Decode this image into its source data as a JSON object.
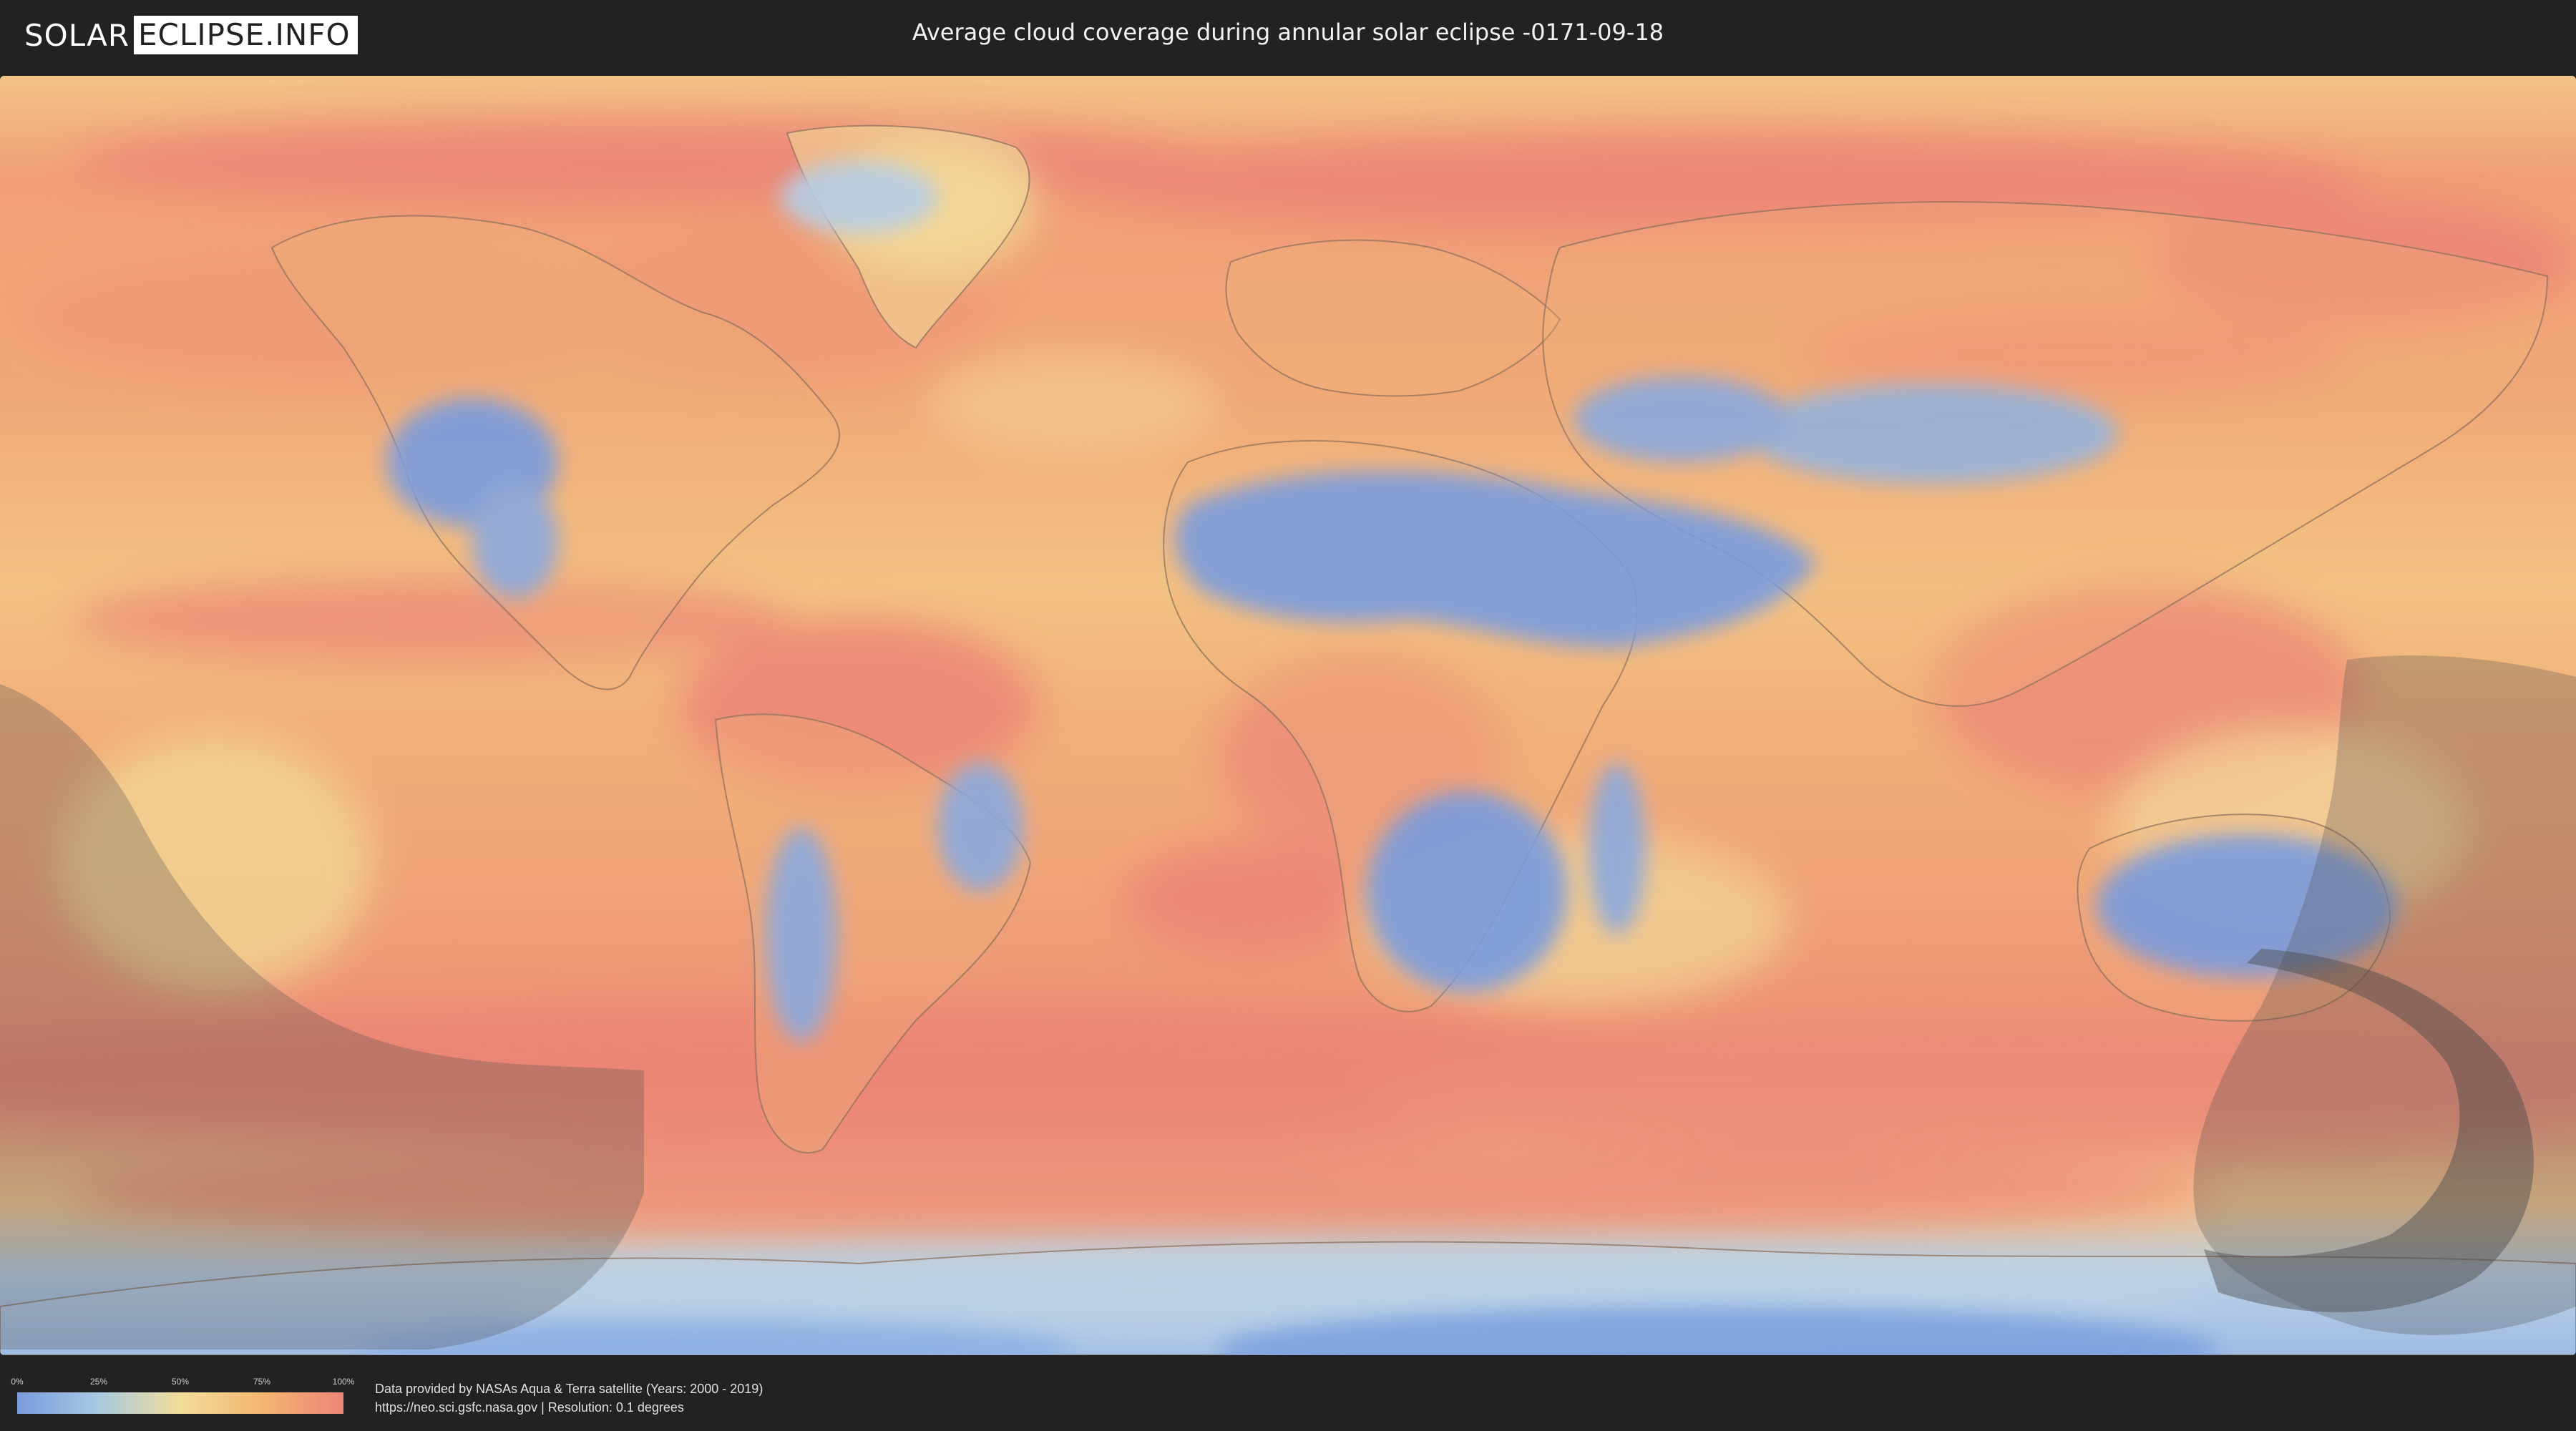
{
  "header": {
    "logo_part1": "SOLAR",
    "logo_part2": "ECLIPSE.INFO",
    "title": "Average cloud coverage during annular solar eclipse -0171-09-18"
  },
  "legend": {
    "ticks": [
      "0%",
      "25%",
      "50%",
      "75%",
      "100%"
    ],
    "colors": [
      "#7a9cde",
      "#a8c9e0",
      "#f2dd9a",
      "#f3b672",
      "#ec8577"
    ]
  },
  "footer": {
    "credit_line1": "Data provided by NASAs Aqua & Terra satellite (Years: 2000 - 2019)",
    "credit_line2": "https://neo.sci.gsfc.nasa.gov | Resolution: 0.1 degrees"
  },
  "map": {
    "colors": {
      "cloudy": "#ec8577",
      "moderate": "#f3b672",
      "partly": "#f2dd9a",
      "clear": "#7a9cde",
      "border": "#8a6e5a",
      "eclipse_overlay": "#4a4a4a"
    }
  }
}
